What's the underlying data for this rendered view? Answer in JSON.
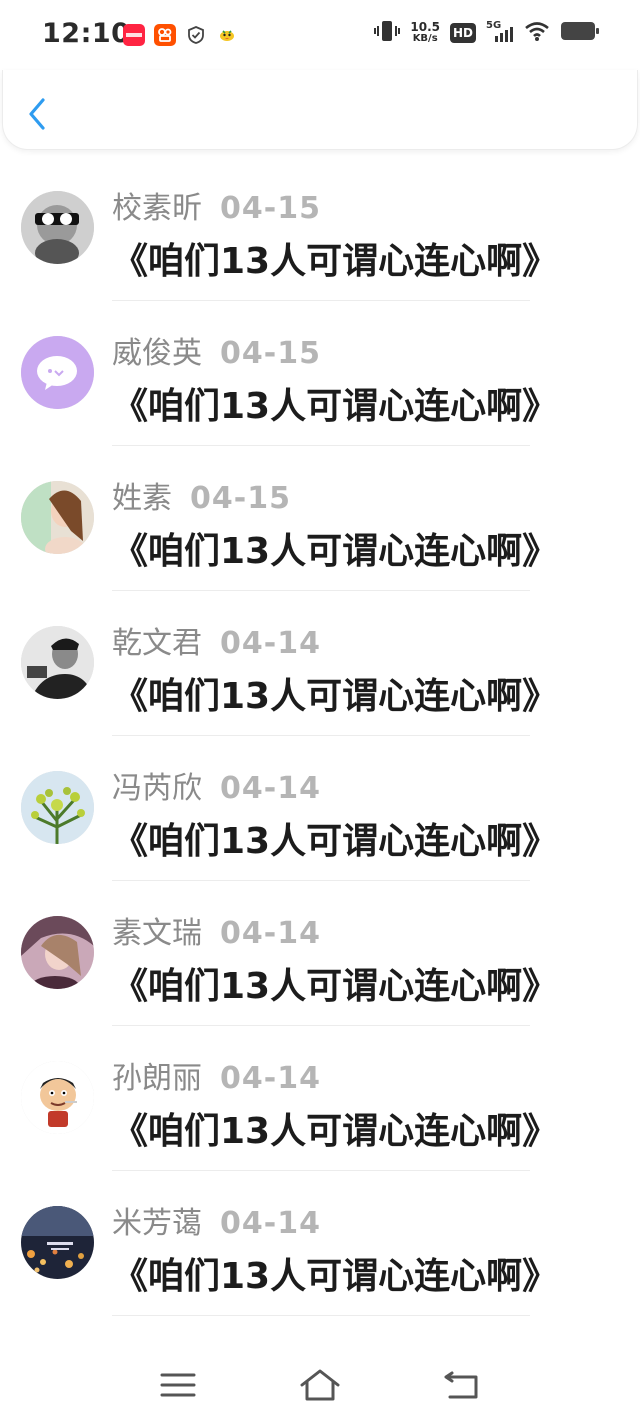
{
  "status_bar": {
    "time": "12:10",
    "notification_icons": [
      "xiaohongshu-icon",
      "kuaishou-icon",
      "shield-check-icon",
      "chick-icon"
    ],
    "net_speed_value": "10.5",
    "net_speed_unit": "KB/s",
    "hd_label": "HD",
    "network_label": "5G",
    "icons": [
      "vibrate-icon",
      "signal-icon",
      "wifi-icon",
      "battery-icon"
    ]
  },
  "header": {
    "back_icon": "chevron-left-icon",
    "accent_color": "#2e9cf0"
  },
  "comments": [
    {
      "name": "校素昕",
      "date": "04-15",
      "title": "《咱们13人可谓心连心啊》"
    },
    {
      "name": "威俊英",
      "date": "04-15",
      "title": "《咱们13人可谓心连心啊》"
    },
    {
      "name": "姓素",
      "date": "04-15",
      "title": "《咱们13人可谓心连心啊》"
    },
    {
      "name": "乾文君",
      "date": "04-14",
      "title": "《咱们13人可谓心连心啊》"
    },
    {
      "name": "冯芮欣",
      "date": "04-14",
      "title": "《咱们13人可谓心连心啊》"
    },
    {
      "name": "素文瑞",
      "date": "04-14",
      "title": "《咱们13人可谓心连心啊》"
    },
    {
      "name": "孙朗丽",
      "date": "04-14",
      "title": "《咱们13人可谓心连心啊》"
    },
    {
      "name": "米芳蔼",
      "date": "04-14",
      "title": "《咱们13人可谓心连心啊》"
    }
  ],
  "bottom_nav": {
    "icons": [
      "menu-icon",
      "home-icon",
      "back-icon"
    ]
  }
}
